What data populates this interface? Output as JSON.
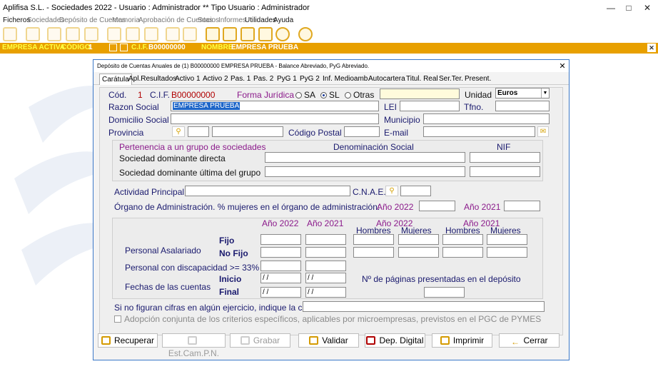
{
  "window": {
    "title": "Aplifisa S.L.  - Sociedades 2022 - Usuario : Administrador  **  Tipo Usuario : Administrador"
  },
  "menu": [
    "Ficheros",
    "Sociedades",
    "Depósito de Cuentas",
    "Memoria",
    "Aprobación de Cuentas",
    "Socios",
    "Informes",
    "Utilidades",
    "Ayuda"
  ],
  "empresa_bar": {
    "label": "EMPRESA ACTIVA",
    "codigo_label": "CÓDIGO",
    "codigo": "1",
    "cif_label": "C.I.F.",
    "cif": "B00000000",
    "nombre_label": "NOMBRE",
    "nombre": "EMPRESA PRUEBA"
  },
  "dialog": {
    "title": "Depósito de Cuentas Anuales de (1) B00000000 EMPRESA PRUEBA - Balance Abreviado, PyG Abreviado.",
    "tabs": [
      "Carátula",
      "Apl.Resultados",
      "Activo 1",
      "Activo 2",
      "Pas. 1",
      "Pas. 2",
      "PyG 1",
      "PyG 2",
      "Inf. Medioamb.",
      "Autocartera",
      "Titul. Real",
      "Ser.Ter.",
      "Present."
    ],
    "cod_label": "Cód.",
    "cod": "1",
    "cif_label": "C.I.F.",
    "cif": "B00000000",
    "forma_label": "Forma Jurídica",
    "forma_opts": [
      "SA",
      "SL",
      "Otras"
    ],
    "unidad_label": "Unidad",
    "unidad": "Euros",
    "razon_label": "Razon Social",
    "razon": "EMPRESA PRUEBA",
    "lei_label": "LEI",
    "tfno_label": "Tfno.",
    "domicilio_label": "Domicilio Social",
    "municipio_label": "Municipio",
    "provincia_label": "Provincia",
    "cp_label": "Código Postal",
    "email_label": "E-mail",
    "grupo": {
      "title": "Pertenencia a un grupo de sociedades",
      "den_label": "Denominación Social",
      "nif_label": "NIF",
      "directa": "Sociedad dominante directa",
      "ultima": "Sociedad dominante última del grupo"
    },
    "actividad_label": "Actividad Principal",
    "cnae_label": "C.N.A.E.",
    "organo_label": "Órgano de Administración. % mujeres en el órgano de administración:",
    "ano2022": "Año 2022",
    "ano2021": "Año 2021",
    "personal": {
      "hombres": "Hombres",
      "mujeres": "Mujeres",
      "asalariado": "Personal Asalariado",
      "fijo": "Fijo",
      "no_fijo": "No Fijo",
      "discap": "Personal con discapacidad >= 33%",
      "fechas": "Fechas de las cuentas",
      "inicio": "Inicio",
      "final": "Final",
      "fecha_vacia": " / /",
      "paginas": "Nº de páginas presentadas en el depósito"
    },
    "causa_label": "Si no figuran cifras en algún ejercicio, indique la causa",
    "adopcion_label": "Adopción conjunta de los criterios específicos, aplicables por microempresas, previstos en el PGC de PYMES",
    "buttons": {
      "recuperar": "Recuperar",
      "estcam": "Est.Cam.P.N.",
      "grabar": "Grabar",
      "validar": "Validar",
      "deposito": "Dep. Digital",
      "imprimir": "Imprimir",
      "cerrar": "Cerrar"
    }
  }
}
